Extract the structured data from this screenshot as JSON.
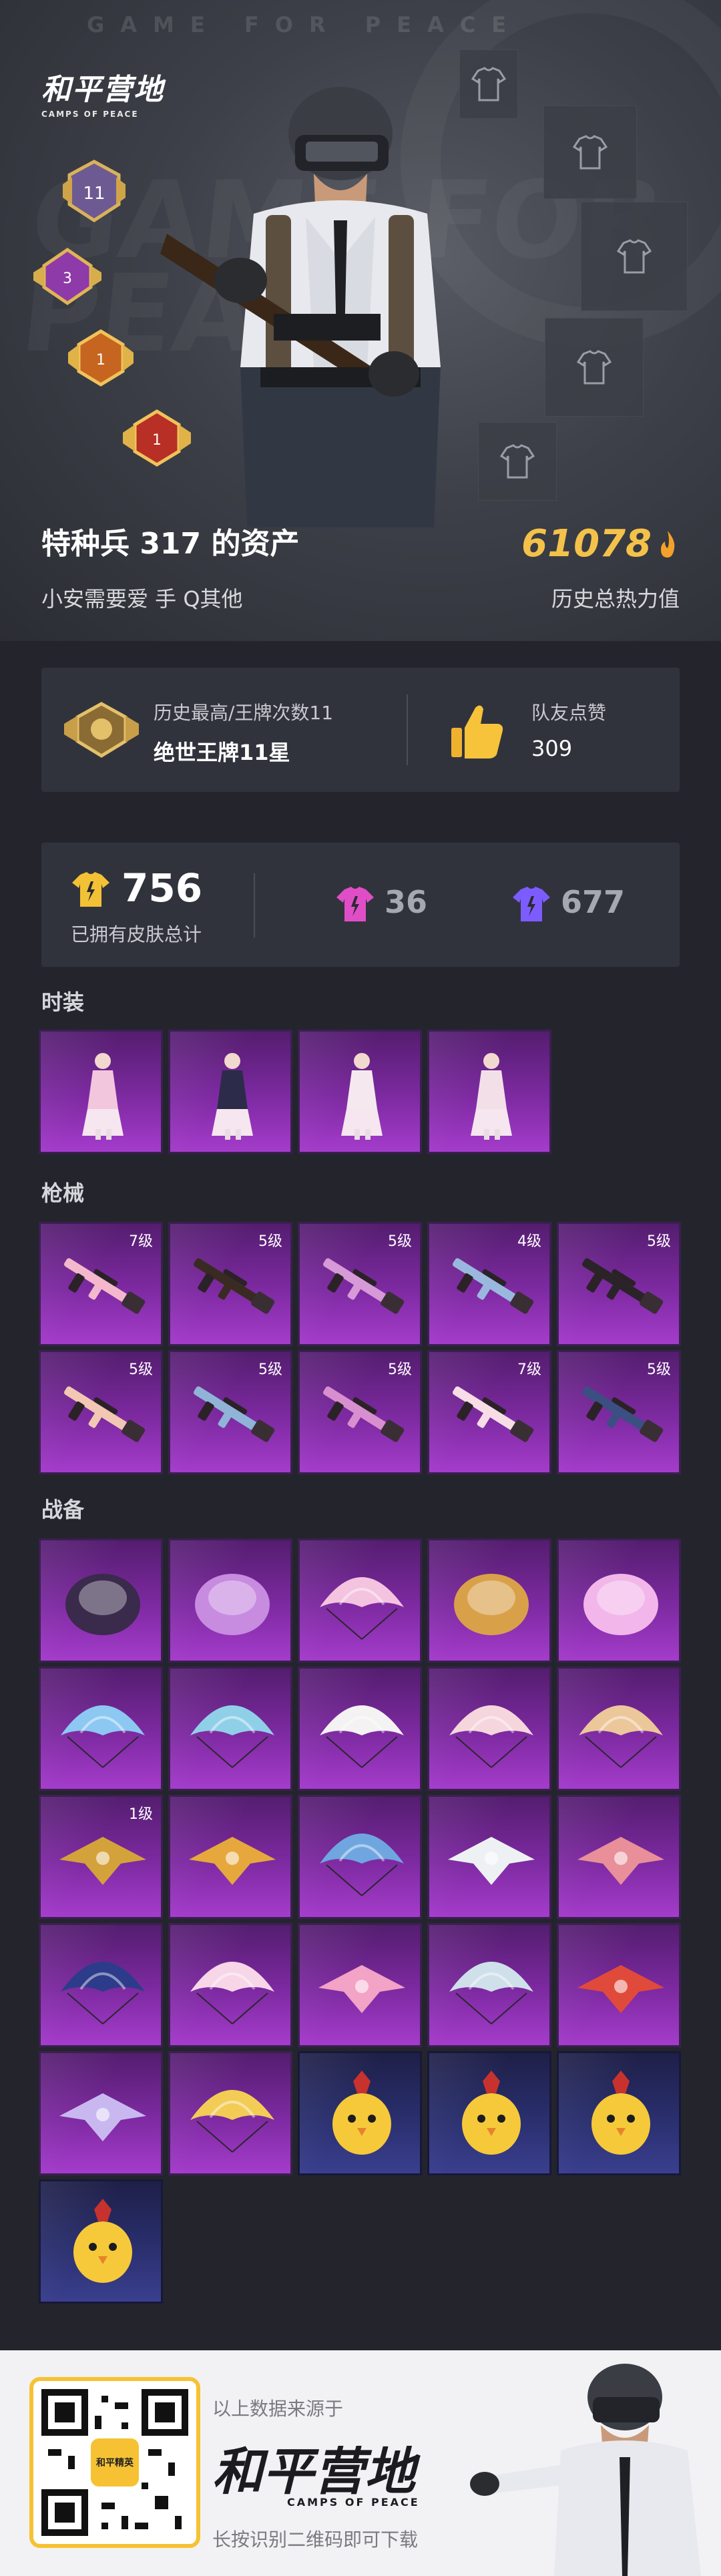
{
  "hero": {
    "watermark": "GAME FOR PEACE",
    "big_watermark": "GAME FOR PEACE",
    "logo_cn": "和平营地",
    "logo_en": "CAMPS OF PEACE",
    "badges": [
      {
        "num": "11",
        "color": "#b9a8d8"
      },
      {
        "num": "3",
        "color": "#c87fd9"
      },
      {
        "num": "1",
        "color": "#e08a34"
      },
      {
        "num": "1",
        "color": "#d14a32"
      }
    ],
    "owner_title": "特种兵 317 的资产",
    "owner_sub": "小安需要爱 手 Q其他",
    "power_value": "61078",
    "power_label": "历史总热力值"
  },
  "rank": {
    "label": "历史最高/王牌次数11",
    "value": "绝世王牌11星",
    "likes_label": "队友点赞",
    "likes_value": "309"
  },
  "skins": {
    "total": "756",
    "total_label": "已拥有皮肤总计",
    "pink_count": "36",
    "purple_count": "677",
    "colors": {
      "gold": "#f3c136",
      "pink": "#e04ec7",
      "purple": "#7d5cff"
    }
  },
  "sections": {
    "fashion": "时装",
    "weapons": "枪械",
    "gear": "战备"
  },
  "weapon_levels": [
    "7级",
    "5级",
    "5级",
    "4级",
    "5级",
    "5级",
    "5级",
    "5级",
    "7级",
    "5级"
  ],
  "gear_level": "1级",
  "footer": {
    "source": "以上数据来源于",
    "brand": "和平营地",
    "brand_en": "CAMPS OF PEACE",
    "hint": "长按识别二维码即可下载",
    "qr_logo": "和平精英"
  }
}
